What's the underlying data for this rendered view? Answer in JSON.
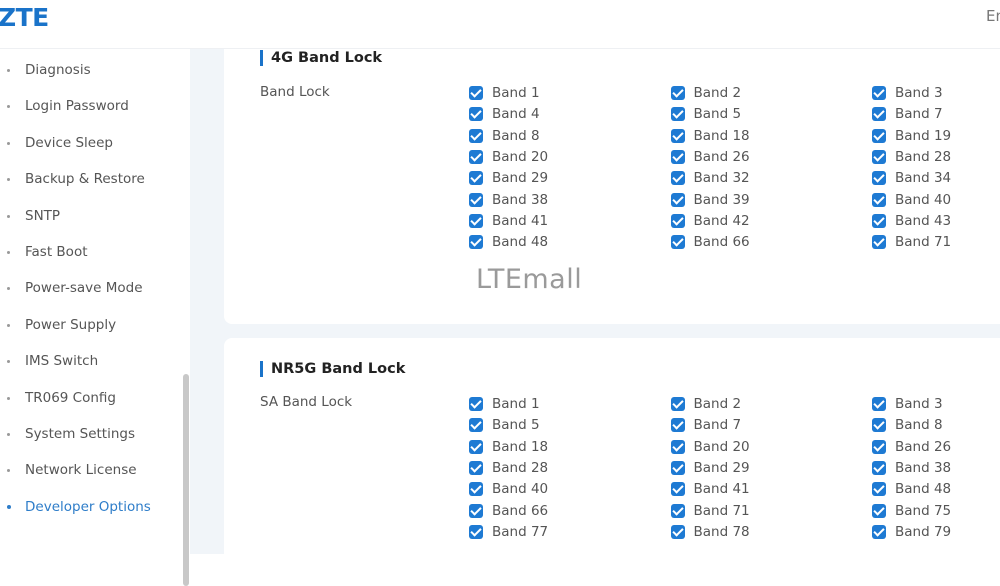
{
  "header": {
    "logo": "ZTE",
    "language": "En"
  },
  "sidebar": {
    "items": [
      {
        "label": "Diagnosis",
        "active": false
      },
      {
        "label": "Login Password",
        "active": false
      },
      {
        "label": "Device Sleep",
        "active": false
      },
      {
        "label": "Backup & Restore",
        "active": false
      },
      {
        "label": "SNTP",
        "active": false
      },
      {
        "label": "Fast Boot",
        "active": false
      },
      {
        "label": "Power-save Mode",
        "active": false
      },
      {
        "label": "Power Supply",
        "active": false
      },
      {
        "label": "IMS Switch",
        "active": false
      },
      {
        "label": "TR069 Config",
        "active": false
      },
      {
        "label": "System Settings",
        "active": false
      },
      {
        "label": "Network License",
        "active": false
      },
      {
        "label": "Developer Options",
        "active": true
      }
    ]
  },
  "lte_section": {
    "title": "4G Band Lock",
    "row_label": "Band Lock",
    "bands": [
      {
        "label": "Band 1",
        "checked": true
      },
      {
        "label": "Band 2",
        "checked": true
      },
      {
        "label": "Band 3",
        "checked": true
      },
      {
        "label": "Band 4",
        "checked": true
      },
      {
        "label": "Band 5",
        "checked": true
      },
      {
        "label": "Band 7",
        "checked": true
      },
      {
        "label": "Band 8",
        "checked": true
      },
      {
        "label": "Band 18",
        "checked": true
      },
      {
        "label": "Band 19",
        "checked": true
      },
      {
        "label": "Band 20",
        "checked": true
      },
      {
        "label": "Band 26",
        "checked": true
      },
      {
        "label": "Band 28",
        "checked": true
      },
      {
        "label": "Band 29",
        "checked": true
      },
      {
        "label": "Band 32",
        "checked": true
      },
      {
        "label": "Band 34",
        "checked": true
      },
      {
        "label": "Band 38",
        "checked": true
      },
      {
        "label": "Band 39",
        "checked": true
      },
      {
        "label": "Band 40",
        "checked": true
      },
      {
        "label": "Band 41",
        "checked": true
      },
      {
        "label": "Band 42",
        "checked": true
      },
      {
        "label": "Band 43",
        "checked": true
      },
      {
        "label": "Band 48",
        "checked": true
      },
      {
        "label": "Band 66",
        "checked": true
      },
      {
        "label": "Band 71",
        "checked": true
      }
    ]
  },
  "watermark": "LTEmall",
  "nr5g_section": {
    "title": "NR5G Band Lock",
    "row_label": "SA Band Lock",
    "bands": [
      {
        "label": "Band 1",
        "checked": true
      },
      {
        "label": "Band 2",
        "checked": true
      },
      {
        "label": "Band 3",
        "checked": true
      },
      {
        "label": "Band 5",
        "checked": true
      },
      {
        "label": "Band 7",
        "checked": true
      },
      {
        "label": "Band 8",
        "checked": true
      },
      {
        "label": "Band 18",
        "checked": true
      },
      {
        "label": "Band 20",
        "checked": true
      },
      {
        "label": "Band 26",
        "checked": true
      },
      {
        "label": "Band 28",
        "checked": true
      },
      {
        "label": "Band 29",
        "checked": true
      },
      {
        "label": "Band 38",
        "checked": true
      },
      {
        "label": "Band 40",
        "checked": true
      },
      {
        "label": "Band 41",
        "checked": true
      },
      {
        "label": "Band 48",
        "checked": true
      },
      {
        "label": "Band 66",
        "checked": true
      },
      {
        "label": "Band 71",
        "checked": true
      },
      {
        "label": "Band 75",
        "checked": true
      },
      {
        "label": "Band 77",
        "checked": true
      },
      {
        "label": "Band 78",
        "checked": true
      },
      {
        "label": "Band 79",
        "checked": true
      }
    ]
  },
  "colors": {
    "accent": "#1e7ad3",
    "active_nav": "#2e7dc9",
    "page_background": "#f1f5f9"
  }
}
